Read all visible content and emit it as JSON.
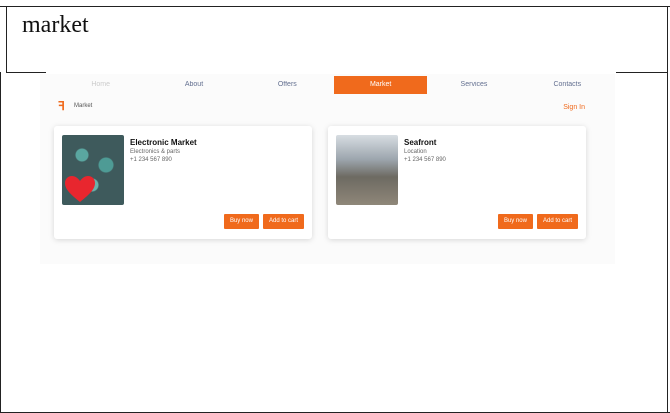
{
  "document": {
    "word": "market"
  },
  "app": {
    "nav": [
      {
        "label": "Home",
        "active": false
      },
      {
        "label": "About",
        "active": false
      },
      {
        "label": "Offers",
        "active": false
      },
      {
        "label": "Market",
        "active": true
      },
      {
        "label": "Services",
        "active": false
      },
      {
        "label": "Contacts",
        "active": false
      }
    ],
    "brand": {
      "name": "Market"
    },
    "signin_label": "Sign In",
    "cards": [
      {
        "title": "Electronic Market",
        "lines": [
          "Electronics & parts",
          "+1 234 567 890"
        ],
        "buttons": [
          "Buy now",
          "Add to cart"
        ]
      },
      {
        "title": "Seafront",
        "lines": [
          "Location",
          "+1 234 567 890"
        ],
        "buttons": [
          "Buy now",
          "Add to cart"
        ]
      }
    ],
    "colors": {
      "accent": "#f06a1c"
    }
  }
}
